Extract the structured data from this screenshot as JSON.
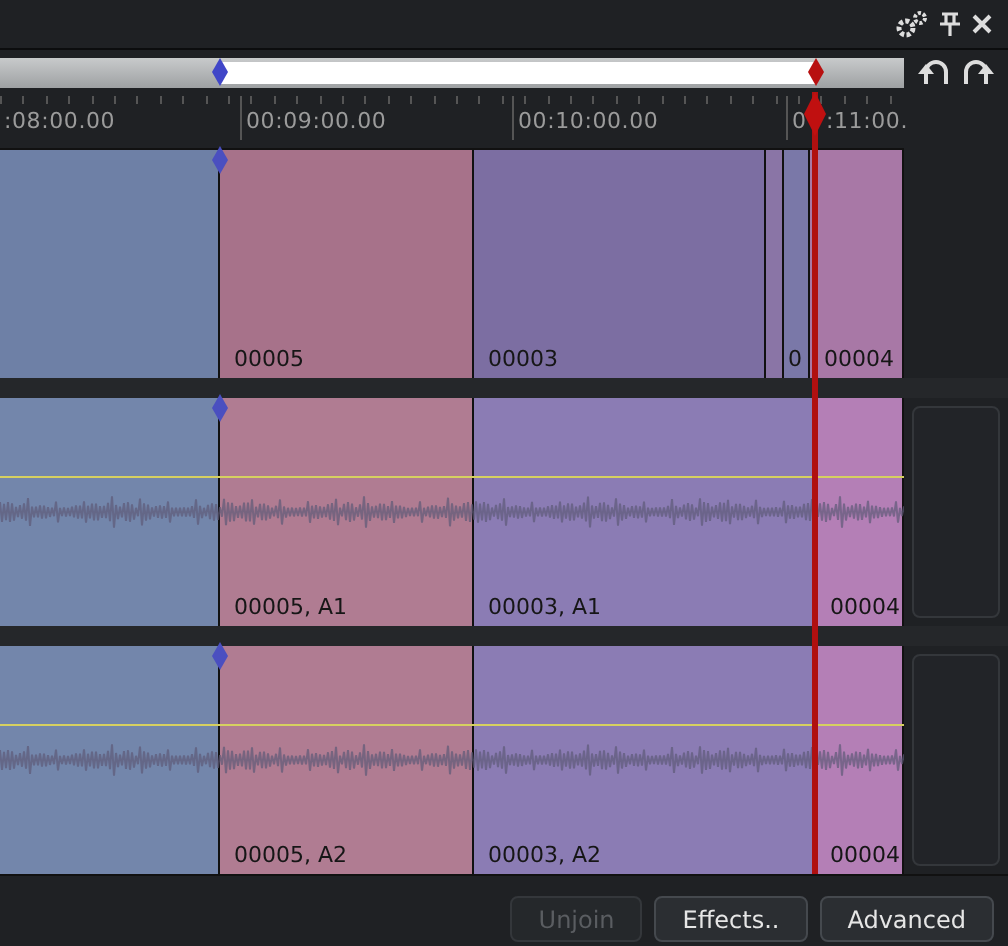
{
  "ruler": {
    "labels": [
      ":08:00.00",
      "00:09:00.00",
      "00:10:00.00",
      "0",
      ":11:00."
    ]
  },
  "tracks": [
    {
      "kind": "video",
      "clips": [
        {
          "color": "#6e80a6"
        },
        {
          "label": "00005",
          "color": "#a7728a"
        },
        {
          "label": "00003",
          "color": "#7c6ea2"
        },
        {
          "color": "#8a75a6"
        },
        {
          "label": "0",
          "color": "#7a78a8"
        },
        {
          "label": "00004",
          "color": "#a878a6"
        }
      ]
    },
    {
      "kind": "audio",
      "clips": [
        {
          "color": "#7386ab"
        },
        {
          "label": "00005, A1",
          "color": "#b07c92"
        },
        {
          "label": "00003, A1",
          "color": "#8b7cb4"
        },
        {
          "label": "00004",
          "color": "#b47fb6"
        }
      ]
    },
    {
      "kind": "audio",
      "clips": [
        {
          "color": "#7386ab"
        },
        {
          "label": "00005, A2",
          "color": "#b07c92"
        },
        {
          "label": "00003, A2",
          "color": "#8b7cb4"
        },
        {
          "label": "00004",
          "color": "#b47fb6"
        }
      ]
    }
  ],
  "buttons": [
    {
      "label": "Unjoin",
      "disabled": true
    },
    {
      "label": "Effects..",
      "disabled": false
    },
    {
      "label": "Advanced",
      "disabled": false
    }
  ]
}
